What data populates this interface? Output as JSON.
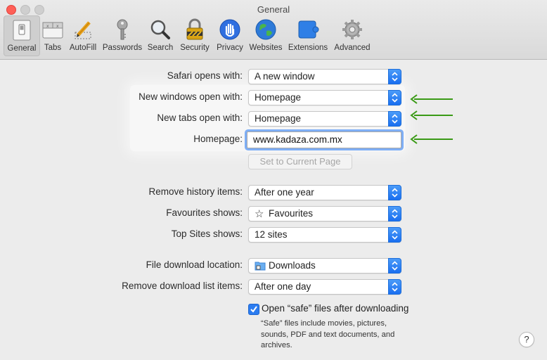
{
  "window": {
    "title": "General"
  },
  "toolbar": {
    "items": [
      {
        "label": "General",
        "icon": "general-switch-icon",
        "selected": true
      },
      {
        "label": "Tabs",
        "icon": "tabs-icon"
      },
      {
        "label": "AutoFill",
        "icon": "autofill-pencil-icon"
      },
      {
        "label": "Passwords",
        "icon": "key-icon"
      },
      {
        "label": "Search",
        "icon": "magnifier-icon"
      },
      {
        "label": "Security",
        "icon": "padlock-icon"
      },
      {
        "label": "Privacy",
        "icon": "hand-icon"
      },
      {
        "label": "Websites",
        "icon": "globe-icon"
      },
      {
        "label": "Extensions",
        "icon": "puzzle-compass-icon"
      },
      {
        "label": "Advanced",
        "icon": "gear-icon"
      }
    ]
  },
  "settings": {
    "safari_opens_with": {
      "label": "Safari opens with:",
      "value": "A new window"
    },
    "new_windows": {
      "label": "New windows open with:",
      "value": "Homepage"
    },
    "new_tabs": {
      "label": "New tabs open with:",
      "value": "Homepage"
    },
    "homepage": {
      "label": "Homepage:",
      "value": "www.kadaza.com.mx"
    },
    "set_current_page": {
      "label": "Set to Current Page"
    },
    "remove_history": {
      "label": "Remove history items:",
      "value": "After one year"
    },
    "favourites": {
      "label": "Favourites shows:",
      "value": "Favourites",
      "icon": "star-outline-icon"
    },
    "top_sites": {
      "label": "Top Sites shows:",
      "value": "12 sites"
    },
    "download_location": {
      "label": "File download location:",
      "value": "Downloads",
      "icon": "downloads-folder-icon"
    },
    "remove_download": {
      "label": "Remove download list items:",
      "value": "After one day"
    },
    "open_safe": {
      "label": "Open “safe” files after downloading",
      "checked": true
    },
    "safe_note": "“Safe” files include movies, pictures, sounds, PDF and text documents, and archives."
  },
  "help": {
    "label": "?"
  },
  "annotation": {
    "arrow_color": "#3a9a16"
  },
  "colors": {
    "accent": "#1a6ff0",
    "close": "#ff5f57"
  }
}
